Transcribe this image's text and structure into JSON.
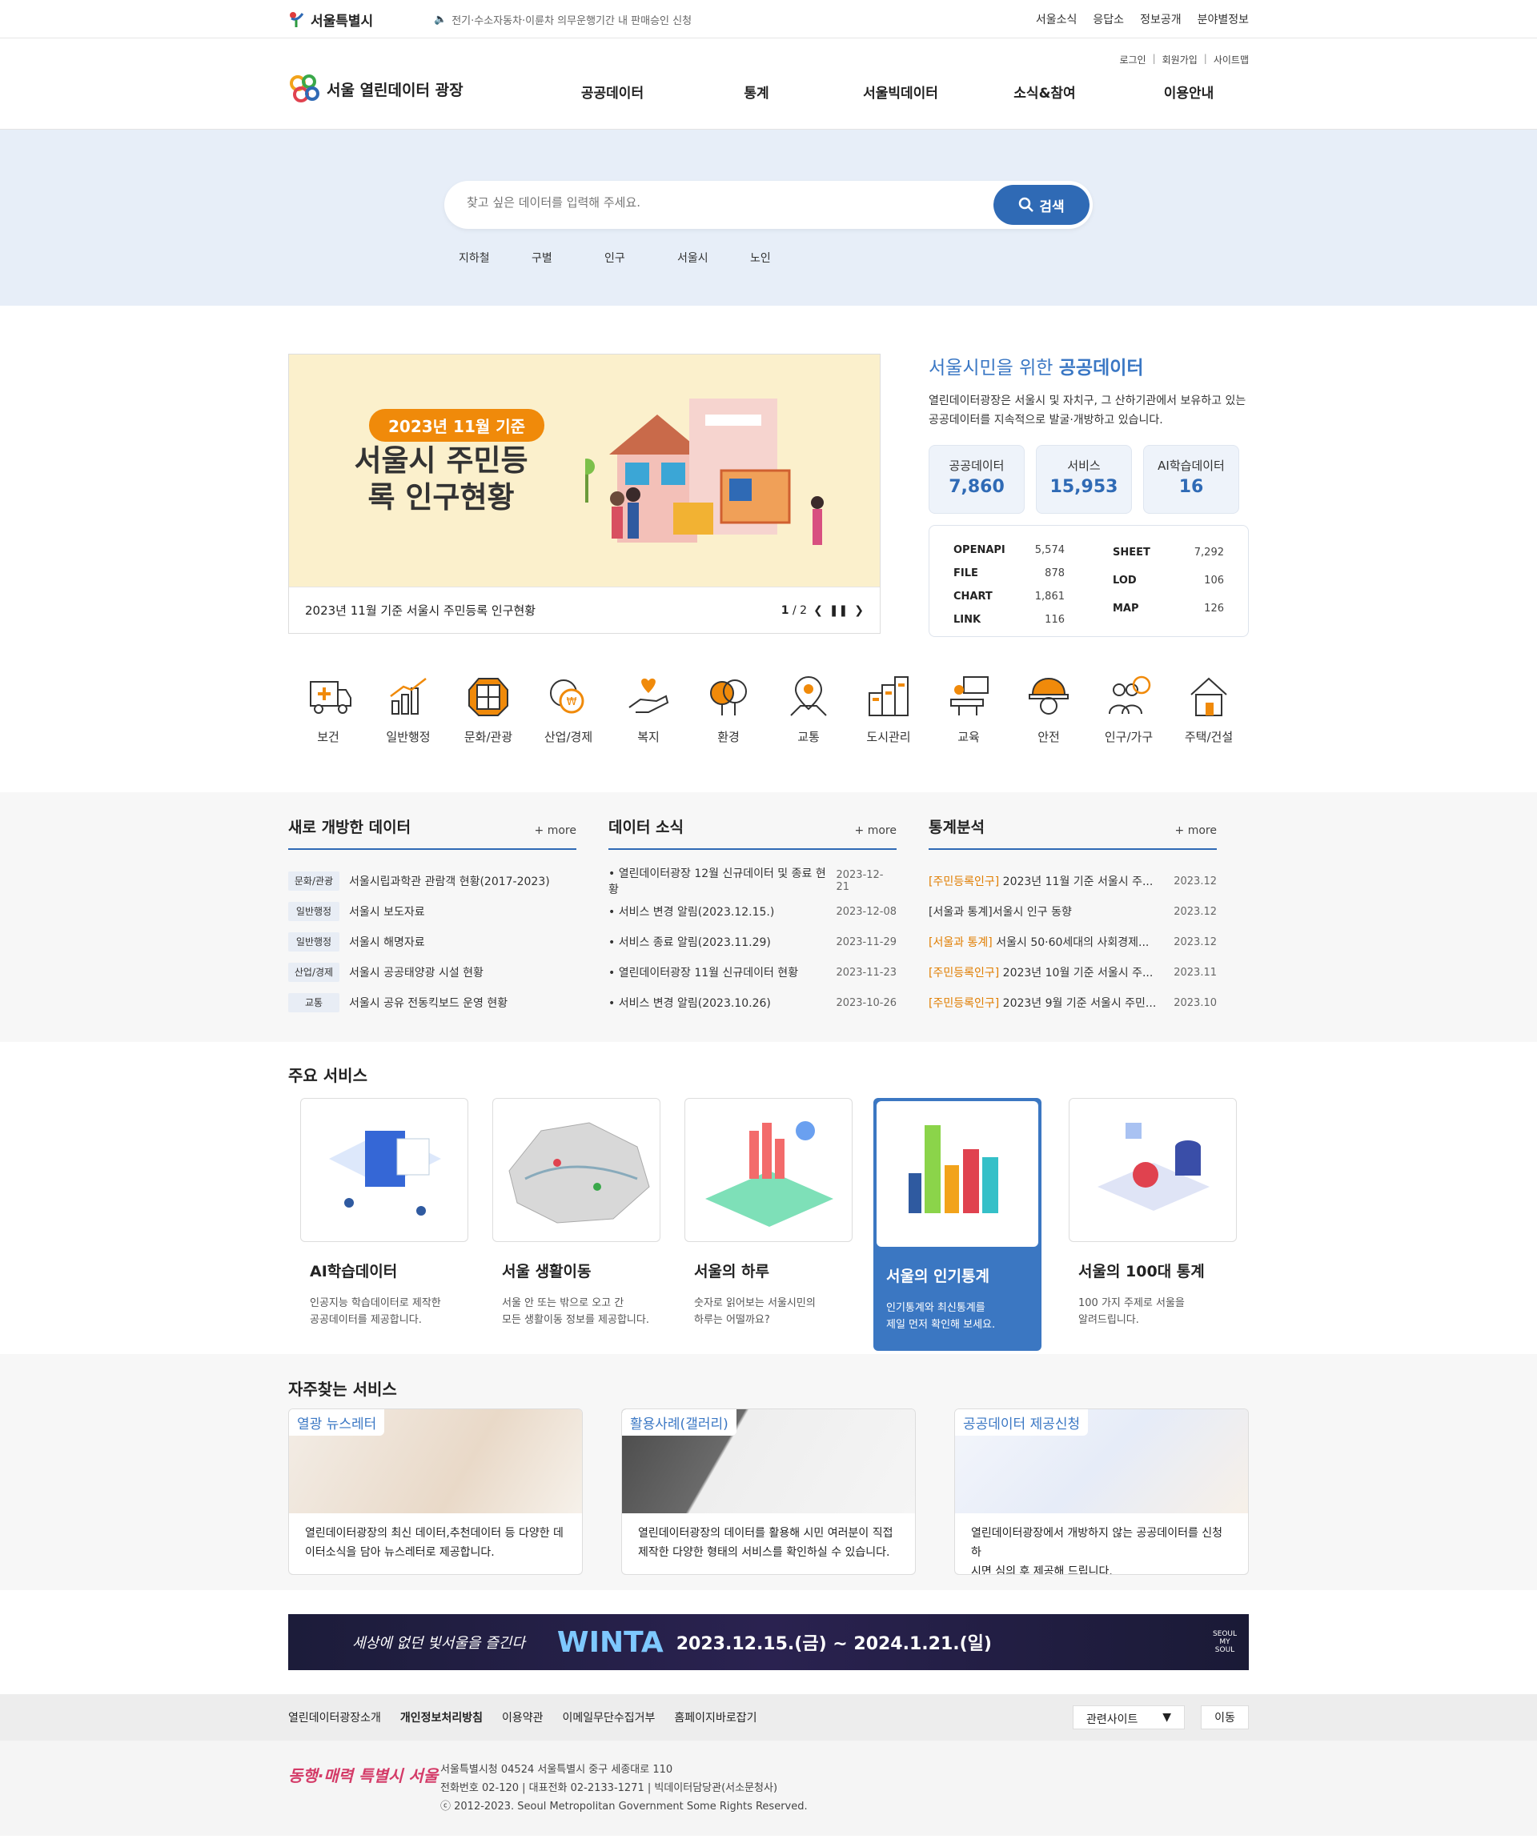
{
  "gov": {
    "logo": "서울특별시",
    "notice": "전기·수소자동차·이륜차 의무운행기간 내 판매승인 신청",
    "links": [
      "서울소식",
      "응답소",
      "정보공개",
      "분야별정보"
    ]
  },
  "header": {
    "util": [
      "로그인",
      "회원가입",
      "사이트맵"
    ],
    "brand": "서울 열린데이터 광장",
    "nav": [
      "공공데이터",
      "통계",
      "서울빅데이터",
      "소식&참여",
      "이용안내"
    ]
  },
  "search": {
    "placeholder": "찾고 싶은 데이터를 입력해 주세요.",
    "button": "검색",
    "keywords": [
      "지하철",
      "구별",
      "인구",
      "서울시",
      "노인"
    ]
  },
  "banner": {
    "pill": "2023년 11월 기준",
    "title": "서울시 주민등록 인구현황",
    "caption": "2023년 11월 기준 서울시 주민등록 인구현황",
    "page": "1",
    "total": "/ 2"
  },
  "intro": {
    "title_pre": "서울시민을 위한",
    "title_em": "공공데이터",
    "desc": "열린데이터광장은 서울시 및 자치구, 그 산하기관에서 보유하고 있는 공공데이터를 지속적으로 발굴·개방하고 있습니다.",
    "stats": [
      {
        "label": "공공데이터",
        "value": "7,860"
      },
      {
        "label": "서비스",
        "value": "15,953"
      },
      {
        "label": "AI학습데이터",
        "value": "16"
      }
    ],
    "types_left": [
      {
        "k": "OPENAPI",
        "v": "5,574"
      },
      {
        "k": "FILE",
        "v": "878"
      },
      {
        "k": "CHART",
        "v": "1,861"
      },
      {
        "k": "LINK",
        "v": "116"
      }
    ],
    "types_right": [
      {
        "k": "SHEET",
        "v": "7,292"
      },
      {
        "k": "LOD",
        "v": "106"
      },
      {
        "k": "MAP",
        "v": "126"
      }
    ]
  },
  "categories": [
    "보건",
    "일반행정",
    "문화/관광",
    "산업/경제",
    "복지",
    "환경",
    "교통",
    "도시관리",
    "교육",
    "안전",
    "인구/가구",
    "주택/건설"
  ],
  "boards": {
    "more": "+ more",
    "new": {
      "title": "새로 개방한 데이터",
      "items": [
        {
          "tag": "문화/관광",
          "text": "서울시립과학관 관람객 현황(2017-2023)"
        },
        {
          "tag": "일반행정",
          "text": "서울시 보도자료"
        },
        {
          "tag": "일반행정",
          "text": "서울시 해명자료"
        },
        {
          "tag": "산업/경제",
          "text": "서울시 공공태양광 시설 현황"
        },
        {
          "tag": "교통",
          "text": "서울시 공유 전동킥보드 운영 현황"
        }
      ]
    },
    "news": {
      "title": "데이터 소식",
      "items": [
        {
          "text": "• 열린데이터광장 12월 신규데이터 및 종료 현황",
          "date": "2023-12-21"
        },
        {
          "text": "• 서비스 변경 알림(2023.12.15.)",
          "date": "2023-12-08"
        },
        {
          "text": "• 서비스 종료 알림(2023.11.29)",
          "date": "2023-11-29"
        },
        {
          "text": "• 열린데이터광장 11월 신규데이터 현황",
          "date": "2023-11-23"
        },
        {
          "text": "• 서비스 변경 알림(2023.10.26)",
          "date": "2023-10-26"
        }
      ]
    },
    "stats": {
      "title": "통계분석",
      "items": [
        {
          "hl": "[주민등록인구]",
          "text": " 2023년 11월 기준 서울시 주...",
          "date": "2023.12"
        },
        {
          "hl": "",
          "text": "[서울과 통계]서울시 인구 동향",
          "date": "2023.12"
        },
        {
          "hl": "[서울과 통계]",
          "text": " 서울시 50·60세대의 사회경제...",
          "date": "2023.12"
        },
        {
          "hl": "[주민등록인구]",
          "text": " 2023년 10월 기준 서울시 주...",
          "date": "2023.11"
        },
        {
          "hl": "[주민등록인구]",
          "text": " 2023년 9월 기준 서울시 주민...",
          "date": "2023.10"
        }
      ]
    }
  },
  "services": {
    "title": "주요 서비스",
    "items": [
      {
        "name": "AI학습데이터",
        "desc1": "인공지능 학습데이터로 제작한",
        "desc2": "공공데이터를 제공합니다."
      },
      {
        "name": "서울 생활이동",
        "desc1": "서울 안 또는 밖으로 오고 간",
        "desc2": "모든 생활이동 정보를 제공합니다."
      },
      {
        "name": "서울의 하루",
        "desc1": "숫자로 읽어보는 서울시민의",
        "desc2": "하루는 어떨까요?"
      },
      {
        "name": "서울의 인기통계",
        "desc1": "인기통계와 최신통계를",
        "desc2": "제일 먼저 확인해 보세요."
      },
      {
        "name": "서울의 100대 통계",
        "desc1": "100 가지 주제로 서울을",
        "desc2": "알려드립니다."
      }
    ]
  },
  "frequent": {
    "title": "자주찾는 서비스",
    "items": [
      {
        "label": "열광 뉴스레터",
        "t1": "열린데이터광장의 최신 데이터,추천데이터 등 다양한 데",
        "t2": "이터소식을 담아 뉴스레터로 제공합니다."
      },
      {
        "label": "활용사례(갤러리)",
        "t1": "열린데이터광장의 데이터를 활용해 시민 여러분이 직접",
        "t2": "제작한 다양한 형태의 서비스를 확인하실 수 있습니다."
      },
      {
        "label": "공공데이터 제공신청",
        "t1": "열린데이터광장에서 개방하지 않는 공공데이터를 신청하",
        "t2": "시면 심의 후 제공해 드립니다."
      }
    ]
  },
  "promo": {
    "slogan": "세상에 없던 빛서울을 즐긴다",
    "brand": "WINTA",
    "dates": "2023.12.15.(금) ~ 2024.1.21.(일)",
    "corner": "SEOUL MY SOUL"
  },
  "footer": {
    "links": [
      "열린데이터광장소개",
      "개인정보처리방침",
      "이용약관",
      "이메일무단수집거부",
      "홈페이지바로잡기"
    ],
    "select": "관련사이트",
    "go": "이동",
    "slogan": "동행·매력 특별시 서울",
    "addr1": "서울특별시청 04524 서울특별시 중구 세종대로 110",
    "addr2": "전화번호 02-120 | 대표전화 02-2133-1271 | 빅데이터담당관(서소문청사)",
    "addr3": "ⓒ 2012-2023. Seoul Metropolitan Government Some Rights Reserved."
  },
  "colors": {
    "primary": "#2f6ab5",
    "accent": "#f08a0a",
    "hero_bg": "#e7eef8"
  }
}
